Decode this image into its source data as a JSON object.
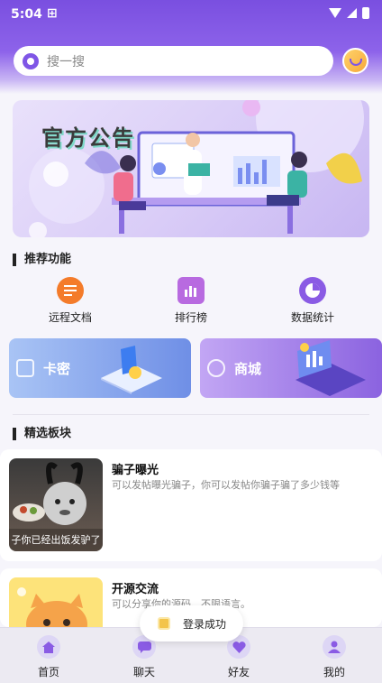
{
  "status": {
    "time": "5:04"
  },
  "search": {
    "placeholder": "搜一搜"
  },
  "banner": {
    "title": "官方公告"
  },
  "sections": {
    "features_title": "推荐功能",
    "boards_title": "精选板块"
  },
  "features": [
    {
      "label": "远程文档",
      "icon": "document-list-icon",
      "color": "#f47b2a"
    },
    {
      "label": "排行榜",
      "icon": "bar-chart-icon",
      "color": "#b86ae0"
    },
    {
      "label": "数据统计",
      "icon": "pie-chart-icon",
      "color": "#8a5be4"
    }
  ],
  "promos": [
    {
      "label": "卡密",
      "icon": "card-icon",
      "color": "#6f8fe6"
    },
    {
      "label": "商城",
      "icon": "shop-bag-icon",
      "color": "#8b63e0"
    }
  ],
  "posts": [
    {
      "title": "骗子曝光",
      "desc": "可以发帖曝光骗子，你可以发帖你骗子骗了多少钱等",
      "thumb_caption": "子你已经出饭发驴了"
    },
    {
      "title": "开源交流",
      "desc": "可以分享你的源码、不限语言。"
    }
  ],
  "toast": {
    "text": "登录成功"
  },
  "tabs": [
    {
      "label": "首页",
      "icon": "home-icon"
    },
    {
      "label": "聊天",
      "icon": "chat-icon"
    },
    {
      "label": "好友",
      "icon": "heart-icon"
    },
    {
      "label": "我的",
      "icon": "user-icon"
    }
  ]
}
